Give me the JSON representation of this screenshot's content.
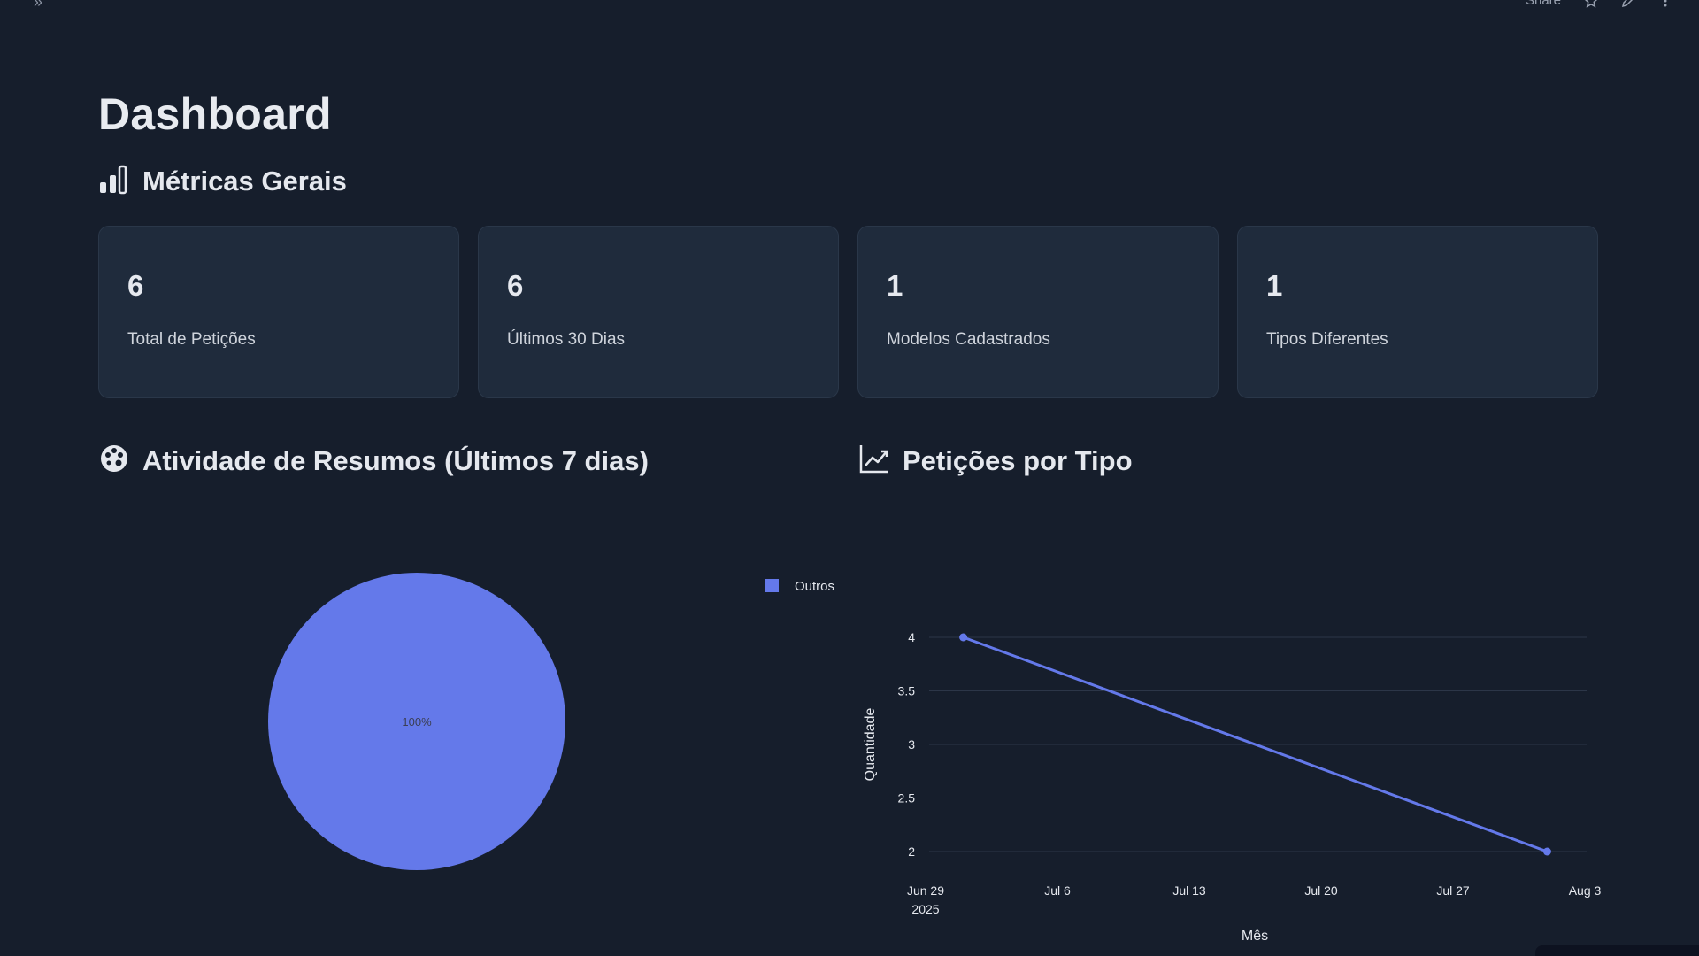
{
  "page": {
    "title": "Dashboard"
  },
  "topbar": {
    "share_label": "Share"
  },
  "sections": {
    "metrics_title": "Métricas Gerais",
    "activity_title": "Atividade de Resumos (Últimos 7 dias)",
    "types_title": "Petições por Tipo"
  },
  "metrics": [
    {
      "value": "6",
      "label": "Total de Petições"
    },
    {
      "value": "6",
      "label": "Últimos 30 Dias"
    },
    {
      "value": "1",
      "label": "Modelos Cadastrados"
    },
    {
      "value": "1",
      "label": "Tipos Diferentes"
    }
  ],
  "colors": {
    "background": "#161e2c",
    "card": "#1f2b3c",
    "accent": "#6479ea",
    "grid": "#2c3648"
  },
  "icons": {
    "metrics": "bar-chart-icon",
    "activity": "palette-icon",
    "types": "line-chart-icon"
  },
  "chart_data": [
    {
      "type": "pie",
      "labels": [
        "Outros"
      ],
      "values": [
        100
      ],
      "data_labels": [
        "100%"
      ],
      "legend": [
        "Outros"
      ],
      "legend_position": "top-right"
    },
    {
      "type": "line",
      "x": [
        "2025-07-01",
        "2025-08-01"
      ],
      "series": [
        {
          "values": [
            4,
            2
          ]
        }
      ],
      "xlabel": "Mês",
      "ylabel": "Quantidade",
      "xticks": [
        "Jun 29",
        "Jul 6",
        "Jul 13",
        "Jul 20",
        "Jul 27",
        "Aug 3"
      ],
      "xtick_sublabel": "2025",
      "yticks": [
        "2",
        "2.5",
        "3",
        "3.5",
        "4"
      ],
      "ylim": [
        2,
        4
      ],
      "xlim": [
        "2025-06-29",
        "2025-08-03"
      ],
      "grid": true
    }
  ]
}
